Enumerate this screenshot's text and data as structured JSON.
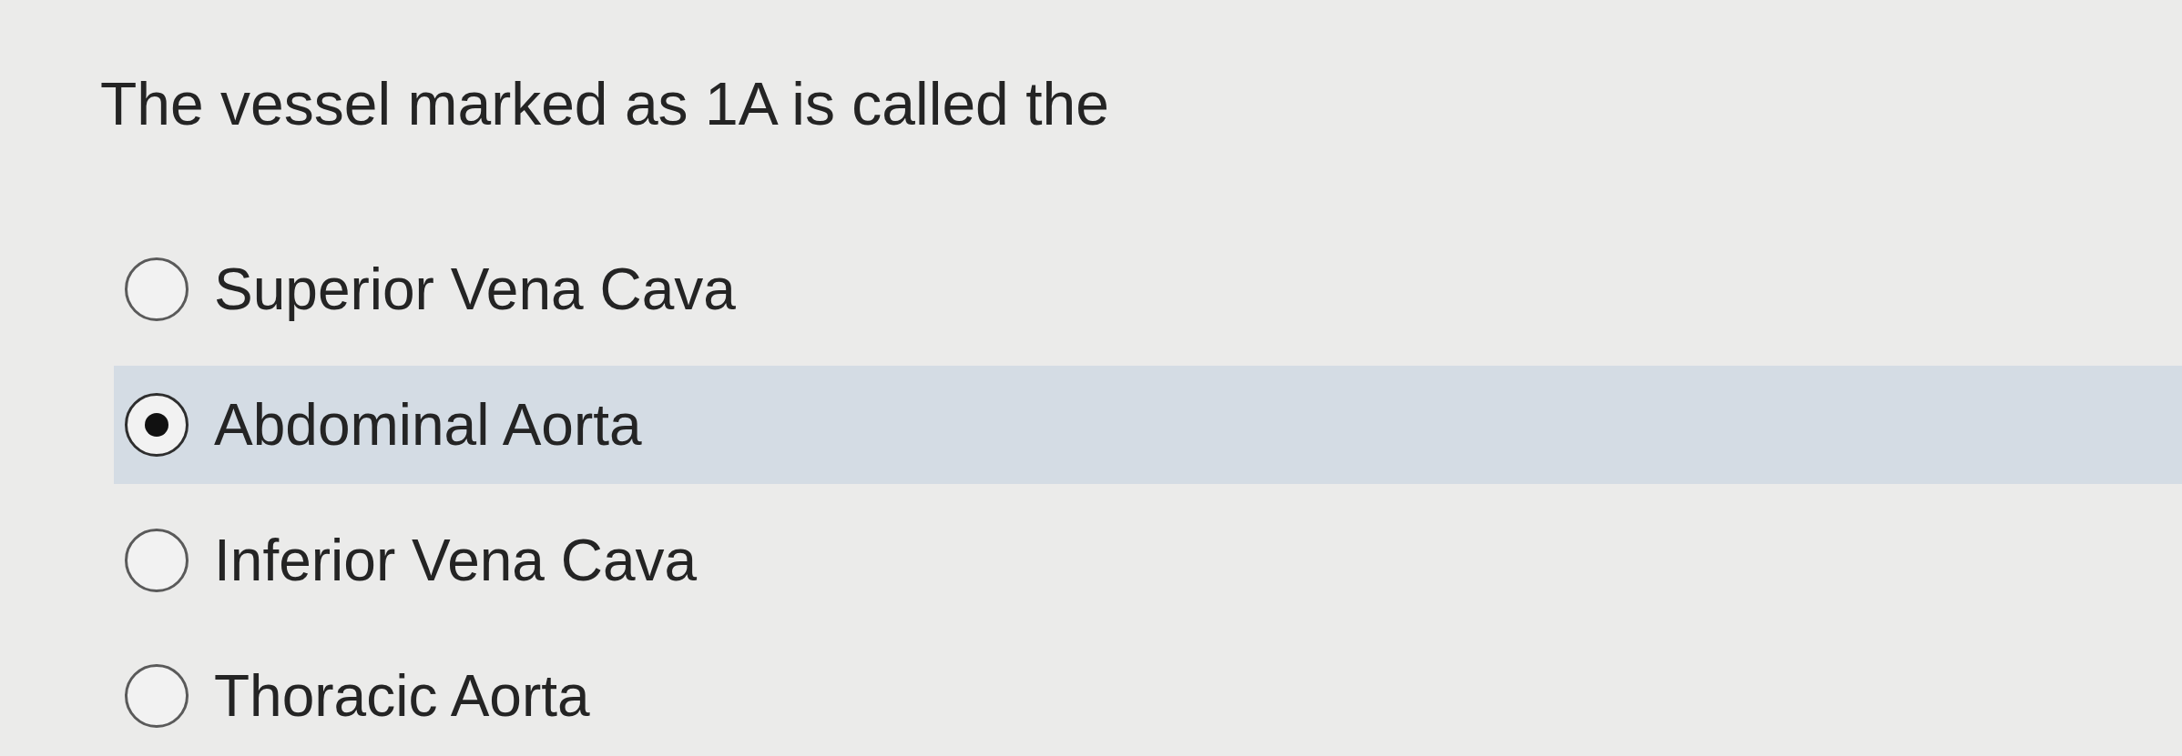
{
  "question": {
    "text": "The vessel marked as 1A is called the"
  },
  "options": [
    {
      "label": "Superior Vena Cava",
      "selected": false
    },
    {
      "label": "Abdominal Aorta",
      "selected": true
    },
    {
      "label": "Inferior Vena Cava",
      "selected": false
    },
    {
      "label": "Thoracic Aorta",
      "selected": false
    }
  ]
}
